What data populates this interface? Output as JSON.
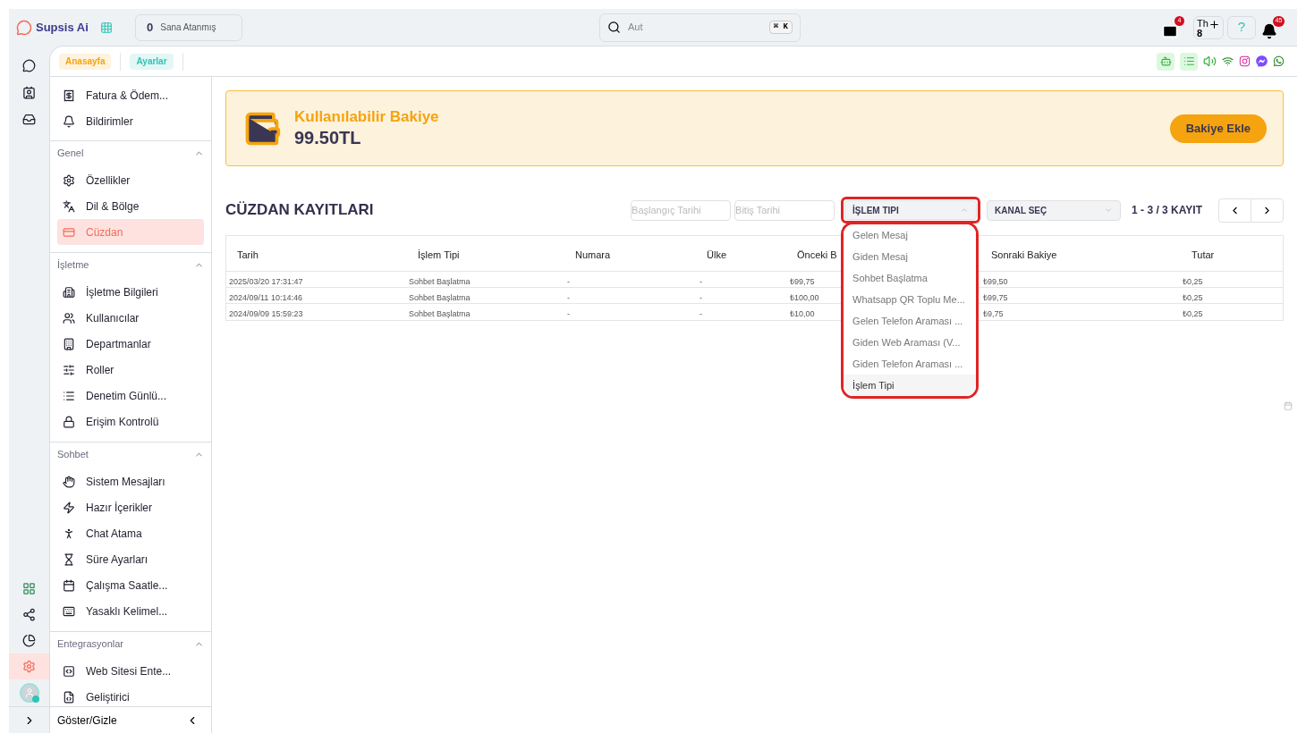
{
  "header": {
    "logo": "Supsis Ai",
    "assigned_count": "0",
    "assigned_label": "Sana Atanmış",
    "search_placeholder": "Aut",
    "shortcut": "⌘ K",
    "mail_badge": "4",
    "user_initials": "Th",
    "user_count": "8",
    "help_label": "?",
    "notification_badge": "45"
  },
  "rail_top": [
    {
      "selected": false
    },
    {
      "selected": false
    },
    {
      "selected": false
    }
  ],
  "rail_bottom": [
    {
      "selected": false
    },
    {
      "selected": false
    },
    {
      "selected": false
    },
    {
      "selected": true
    }
  ],
  "tabs": [
    {
      "label": "Anasayfa",
      "color": "#f5a30f"
    },
    {
      "label": "Ayarlar",
      "color": "#2ec4b6"
    }
  ],
  "sidebar": {
    "top_items": [
      {
        "label": "Fatura & Ödem...",
        "selected": false
      },
      {
        "label": "Bildirimler",
        "selected": false
      }
    ],
    "sections": [
      {
        "title": "Genel",
        "expanded": true,
        "items": [
          {
            "label": "Özellikler",
            "selected": false
          },
          {
            "label": "Dil & Bölge",
            "selected": false
          },
          {
            "label": "Cüzdan",
            "selected": true
          }
        ]
      },
      {
        "title": "İşletme",
        "expanded": true,
        "items": [
          {
            "label": "İşletme Bilgileri",
            "selected": false
          },
          {
            "label": "Kullanıcılar",
            "selected": false
          },
          {
            "label": "Departmanlar",
            "selected": false
          },
          {
            "label": "Roller",
            "selected": false
          },
          {
            "label": "Denetim Günlü...",
            "selected": false
          },
          {
            "label": "Erişim Kontrolü",
            "selected": false
          }
        ]
      },
      {
        "title": "Sohbet",
        "expanded": true,
        "items": [
          {
            "label": "Sistem Mesajları",
            "selected": false
          },
          {
            "label": "Hazır İçerikler",
            "selected": false
          },
          {
            "label": "Chat Atama",
            "selected": false
          },
          {
            "label": "Süre Ayarları",
            "selected": false
          },
          {
            "label": "Çalışma Saatle...",
            "selected": false
          },
          {
            "label": "Yasaklı Kelimel...",
            "selected": false
          }
        ]
      },
      {
        "title": "Entegrasyonlar",
        "expanded": true,
        "items": [
          {
            "label": "Web Sitesi Ente...",
            "selected": false
          },
          {
            "label": "Geliştirici",
            "selected": false
          }
        ]
      }
    ],
    "footer": "Göster/Gizle"
  },
  "balance": {
    "title": "Kullanılabilir Bakiye",
    "amount": "99.50TL",
    "button": "Bakiye Ekle"
  },
  "wallet": {
    "title": "CÜZDAN KAYITLARI",
    "start_placeholder": "Başlangıç Tarihi",
    "end_placeholder": "Bitiş Tarihi",
    "type_select": {
      "label": "İŞLEM TIPI",
      "expanded": true
    },
    "channel_select": {
      "label": "KANAL SEÇ"
    },
    "pagination": "1 - 3 / 3 KAYIT",
    "columns": [
      "Tarih",
      "İşlem Tipi",
      "Numara",
      "Ülke",
      "Önceki B",
      "Sonraki Bakiye",
      "Tutar"
    ],
    "rows": [
      [
        "2025/03/20 17:31:47",
        "Sohbet Başlatma",
        "-",
        "-",
        "₺99,75",
        "₺99,50",
        "₺0,25"
      ],
      [
        "2024/09/11 10:14:46",
        "Sohbet Başlatma",
        "-",
        "-",
        "₺100,00",
        "₺99,75",
        "₺0,25"
      ],
      [
        "2024/09/09 15:59:23",
        "Sohbet Başlatma",
        "-",
        "-",
        "₺10,00",
        "₺9,75",
        "₺0,25"
      ]
    ],
    "type_options": [
      {
        "label": "Gelen Mesaj",
        "selected": false
      },
      {
        "label": "Giden Mesaj",
        "selected": false
      },
      {
        "label": "Sohbet Başlatma",
        "selected": false
      },
      {
        "label": "Whatsapp QR Toplu Me...",
        "selected": false
      },
      {
        "label": "Gelen Telefon Araması ...",
        "selected": false
      },
      {
        "label": "Giden Web Araması (V...",
        "selected": false
      },
      {
        "label": "Giden Telefon Araması ...",
        "selected": false
      },
      {
        "label": "İşlem Tipi",
        "selected": true
      }
    ]
  }
}
